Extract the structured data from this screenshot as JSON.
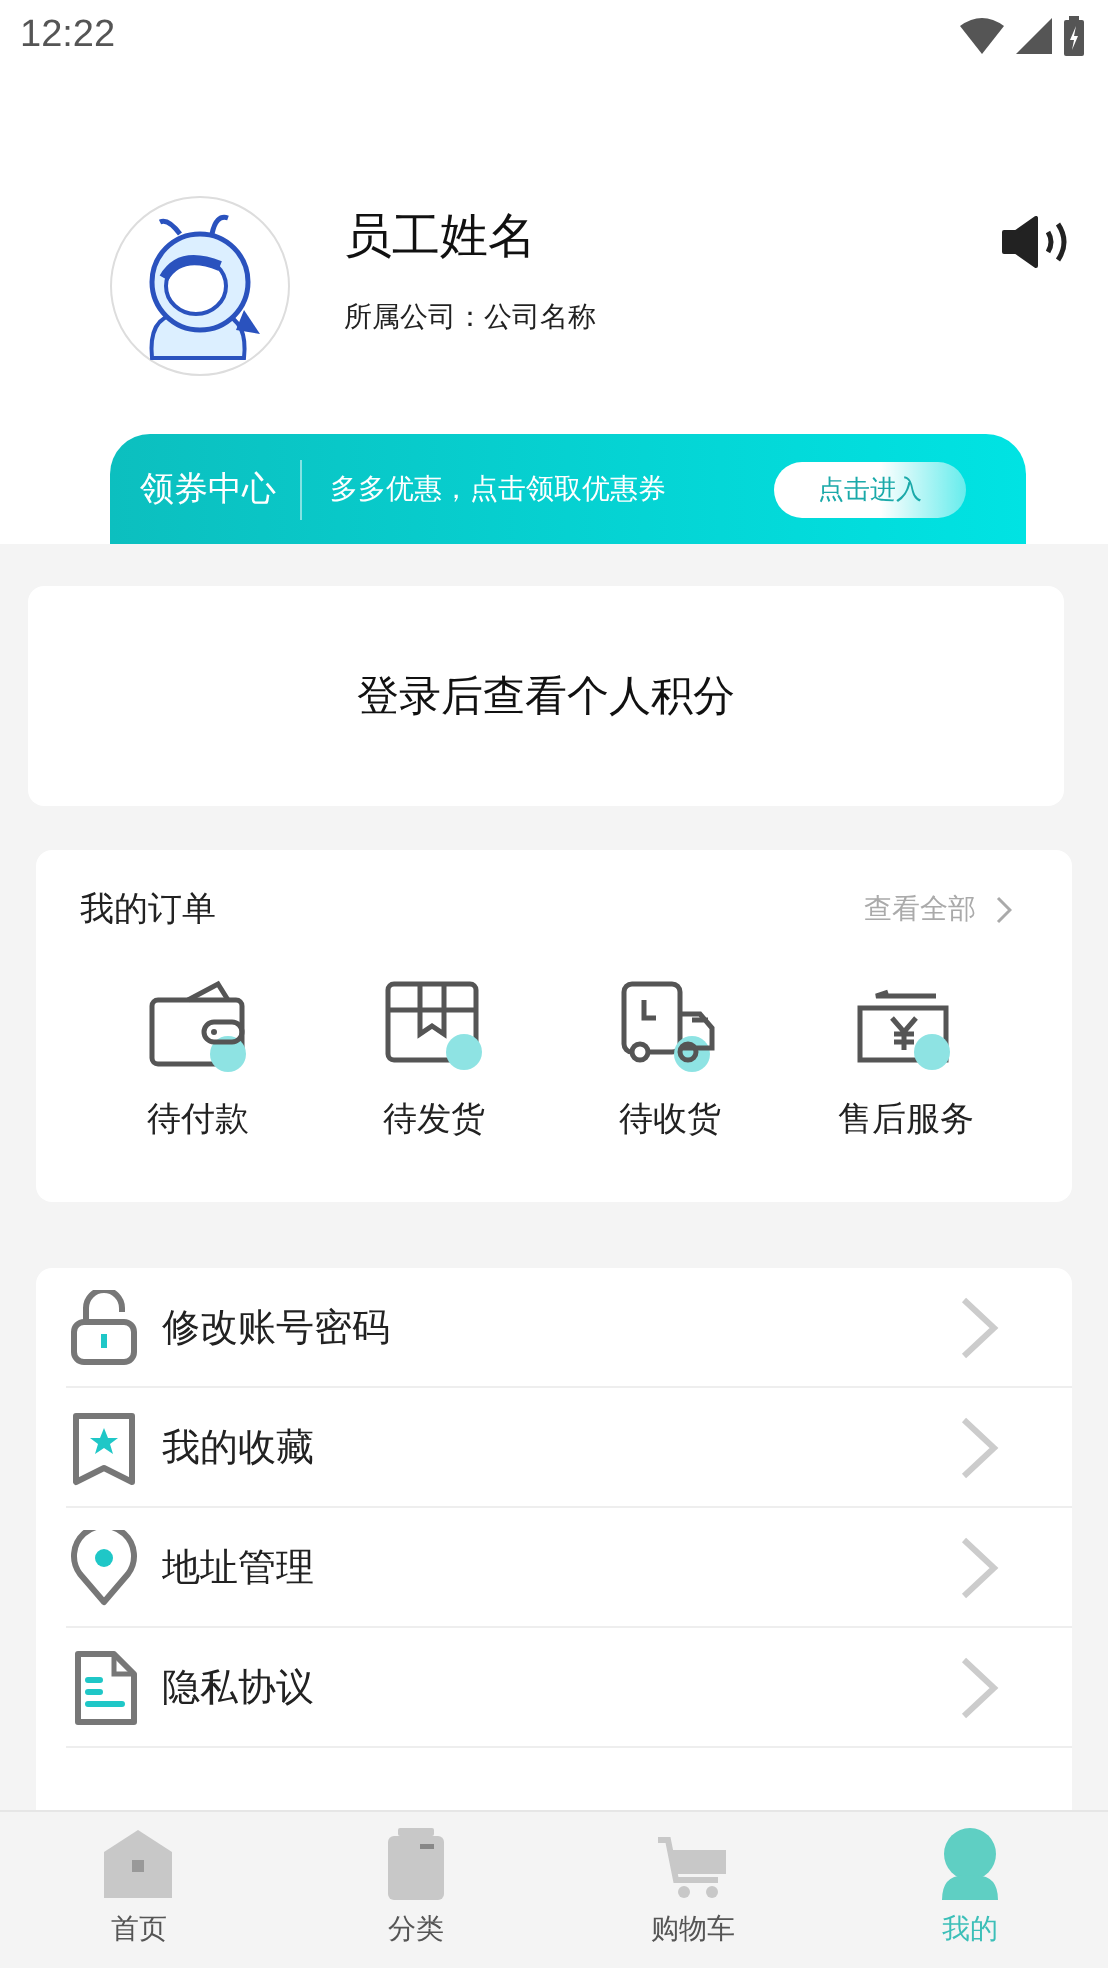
{
  "status_bar": {
    "time": "12:22"
  },
  "profile": {
    "name": "员工姓名",
    "company": "所属公司：公司名称"
  },
  "coupon_banner": {
    "title": "领券中心",
    "text": "多多优惠，点击领取优惠券",
    "button": "点击进入"
  },
  "points_card": {
    "text": "登录后查看个人积分"
  },
  "orders": {
    "title": "我的订单",
    "view_all": "查看全部",
    "items": [
      {
        "label": "待付款",
        "kind": "wallet"
      },
      {
        "label": "待发货",
        "kind": "box"
      },
      {
        "label": "待收货",
        "kind": "truck"
      },
      {
        "label": "售后服务",
        "kind": "refund"
      }
    ]
  },
  "menu": [
    {
      "label": "修改账号密码",
      "kind": "lock"
    },
    {
      "label": "我的收藏",
      "kind": "bookmark"
    },
    {
      "label": "地址管理",
      "kind": "pin"
    },
    {
      "label": "隐私协议",
      "kind": "document"
    }
  ],
  "tab_bar": [
    {
      "label": "首页",
      "kind": "home",
      "selected": false
    },
    {
      "label": "分类",
      "kind": "category",
      "selected": false
    },
    {
      "label": "购物车",
      "kind": "cart",
      "selected": false
    },
    {
      "label": "我的",
      "kind": "person",
      "selected": true
    }
  ]
}
